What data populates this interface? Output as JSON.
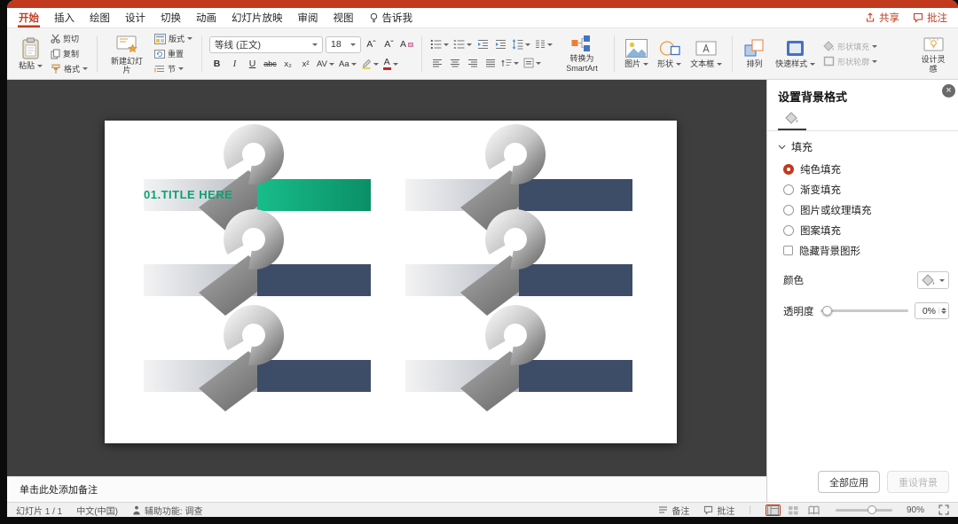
{
  "colors": {
    "accent_red": "#C13A1E",
    "navy": "#3D4D68",
    "green": "#12AE7E",
    "title_green": "#0E9F74",
    "canvas_bg": "#3E3E3E"
  },
  "tabs": {
    "items": [
      {
        "label": "开始",
        "active": true
      },
      {
        "label": "插入"
      },
      {
        "label": "绘图"
      },
      {
        "label": "设计"
      },
      {
        "label": "切换"
      },
      {
        "label": "动画"
      },
      {
        "label": "幻灯片放映"
      },
      {
        "label": "审阅"
      },
      {
        "label": "视图"
      },
      {
        "label": "告诉我",
        "icon": "bulb"
      }
    ],
    "share": "共享",
    "comments": "批注"
  },
  "ribbon": {
    "paste": "粘贴",
    "cut": "剪切",
    "copy": "复制",
    "format_painter": "格式",
    "new_slide": "新建幻灯片",
    "layout": "版式",
    "reset": "重置",
    "section": "节",
    "font_name": "等线 (正文)",
    "font_size": "18",
    "grow_font": "Aˆ",
    "shrink_font": "Aˇ",
    "clear_format": "A",
    "bold": "B",
    "italic": "I",
    "underline": "U",
    "strike": "abc",
    "subscript": "x₂",
    "superscript": "x²",
    "char_spacing": "AV",
    "change_case": "Aa",
    "font_color_glyph": "A",
    "smartart": "转换为SmartArt",
    "picture": "图片",
    "shapes": "形状",
    "textbox": "文本框",
    "arrange": "排列",
    "quick_styles": "快速样式",
    "shape_fill": "形状填充",
    "shape_outline": "形状轮廓",
    "design_ideas": "设计灵感"
  },
  "slide": {
    "banners": [
      {
        "title": "01.TITLE HERE",
        "variant": "green"
      },
      {
        "variant": "navy"
      },
      {
        "variant": "navy"
      },
      {
        "variant": "navy"
      },
      {
        "variant": "navy"
      },
      {
        "variant": "navy"
      }
    ]
  },
  "panel": {
    "title": "设置背景格式",
    "section": "填充",
    "options": [
      {
        "label": "纯色填充",
        "type": "radio",
        "checked": true
      },
      {
        "label": "渐变填充",
        "type": "radio",
        "checked": false
      },
      {
        "label": "图片或纹理填充",
        "type": "radio",
        "checked": false
      },
      {
        "label": "图案填充",
        "type": "radio",
        "checked": false
      },
      {
        "label": "隐藏背景图形",
        "type": "checkbox",
        "checked": false
      }
    ],
    "color_label": "颜色",
    "transparency_label": "透明度",
    "transparency_value": "0%",
    "apply_all": "全部应用",
    "reset_background": "重设背景"
  },
  "notes": {
    "placeholder": "单击此处添加备注"
  },
  "statusbar": {
    "slide_counter": "幻灯片 1 / 1",
    "language": "中文(中国)",
    "accessibility": "辅助功能: 调查",
    "notes": "备注",
    "comments": "批注",
    "zoom": "90%"
  }
}
